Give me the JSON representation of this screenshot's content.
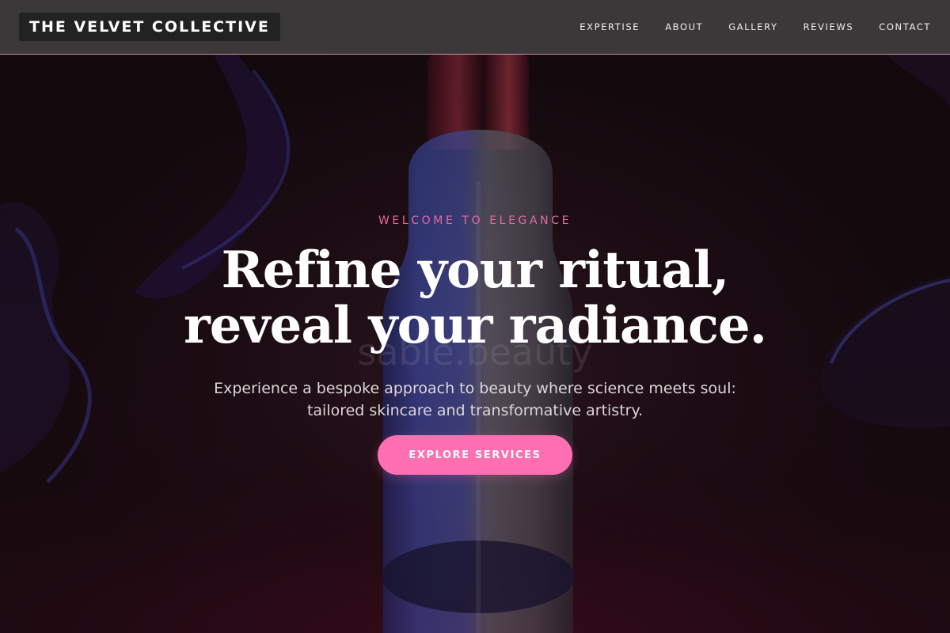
{
  "header": {
    "brand": "THE VELVET COLLECTIVE",
    "nav": [
      {
        "label": "EXPERTISE"
      },
      {
        "label": "ABOUT"
      },
      {
        "label": "GALLERY"
      },
      {
        "label": "REVIEWS"
      },
      {
        "label": "CONTACT"
      }
    ]
  },
  "hero": {
    "eyebrow": "WELCOME TO ELEGANCE",
    "title_line1": "Refine your ritual,",
    "title_line2": "reveal your radiance.",
    "subtitle": "Experience a bespoke approach to beauty where science meets soul: tailored skincare and transformative artistry.",
    "cta_label": "EXPLORE SERVICES",
    "background_image": "cosmetic-bottle-on-dark-magenta-backdrop"
  },
  "colors": {
    "accent": "#ff6fb1",
    "eyebrow": "#e56aa1",
    "header_bg": "#3a3839",
    "header_border": "#d98fa6",
    "hero_bg": "#1d0d14"
  }
}
